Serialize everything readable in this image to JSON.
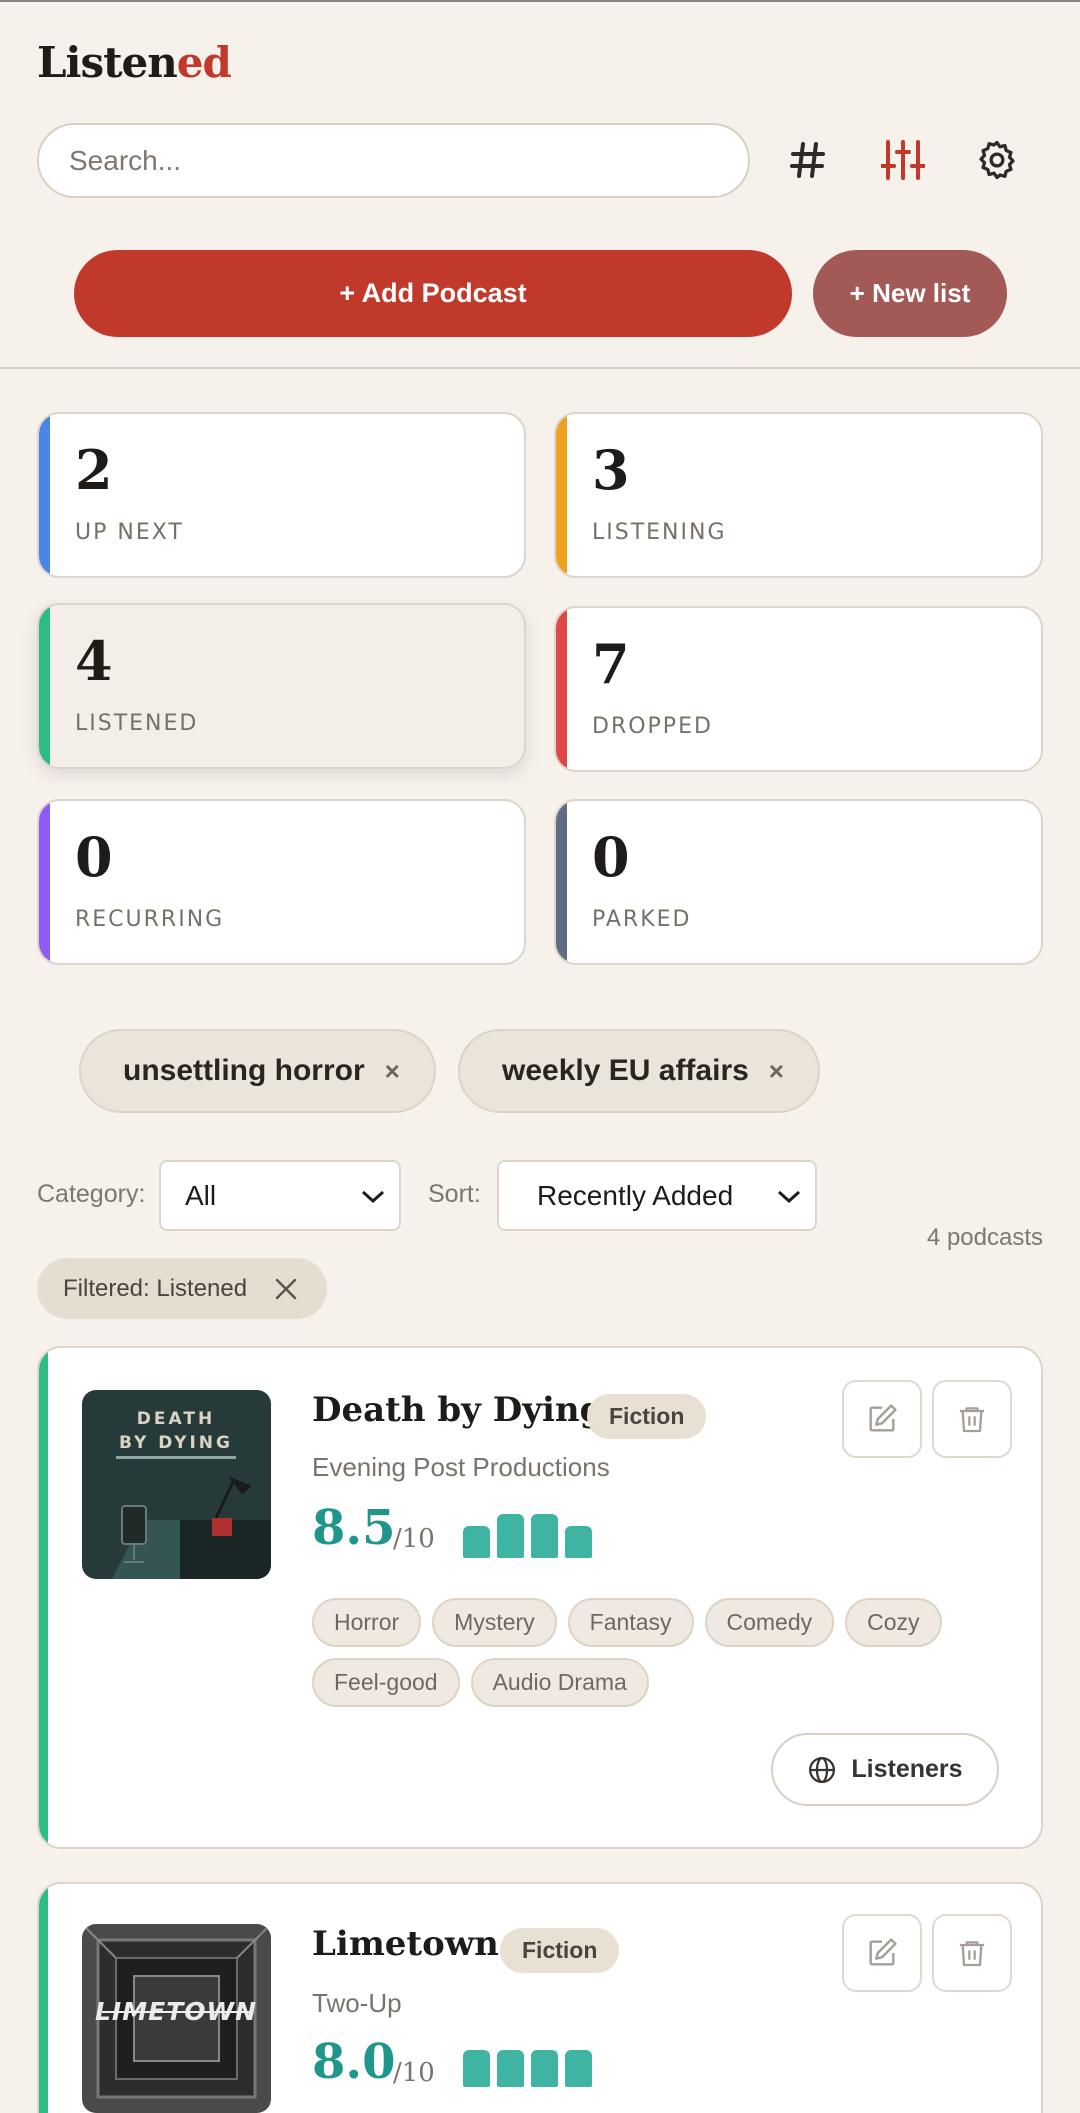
{
  "app": {
    "logo_main": "Listen",
    "logo_accent": "ed"
  },
  "search": {
    "placeholder": "Search..."
  },
  "actions": {
    "add_podcast": "+ Add Podcast",
    "new_list": "+ New list"
  },
  "stats": [
    {
      "count": "2",
      "label": "UP NEXT",
      "color": "#4a86e8"
    },
    {
      "count": "3",
      "label": "LISTENING",
      "color": "#eea020"
    },
    {
      "count": "4",
      "label": "LISTENED",
      "color": "#2dbb87",
      "active": true
    },
    {
      "count": "7",
      "label": "DROPPED",
      "color": "#e04848"
    },
    {
      "count": "0",
      "label": "RECURRING",
      "color": "#8b5cf6"
    },
    {
      "count": "0",
      "label": "PARKED",
      "color": "#5f6c82"
    }
  ],
  "lists": [
    {
      "label": "unsettling horror",
      "remove": "×"
    },
    {
      "label": "weekly EU affairs",
      "remove": "×"
    }
  ],
  "filters": {
    "category_label": "Category:",
    "category_value": "All",
    "sort_label": "Sort:",
    "sort_value": "Recently Added",
    "count_text": "4 podcasts",
    "active_filter": "Filtered: Listened"
  },
  "podcasts": [
    {
      "title": "Death by Dying",
      "category": "Fiction",
      "publisher": "Evening Post Productions",
      "score": "8.5",
      "score_max": "/10",
      "rating_bars": [
        0.72,
        1.0,
        1.0,
        0.72
      ],
      "genres": [
        "Horror",
        "Mystery",
        "Fantasy",
        "Comedy",
        "Cozy",
        "Feel-good",
        "Audio Drama"
      ],
      "listeners_label": "Listeners",
      "cover_text": "DEATH BY DYING"
    },
    {
      "title": "Limetown",
      "category": "Fiction",
      "publisher": "Two-Up",
      "score": "8.0",
      "score_max": "/10",
      "rating_bars": [
        0.85,
        0.85,
        0.85,
        0.85
      ],
      "cover_text": "LIMETOWN"
    }
  ]
}
